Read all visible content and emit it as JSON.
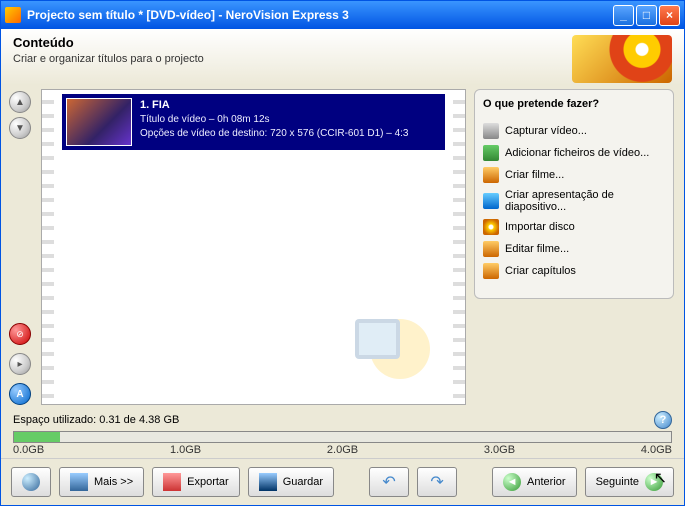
{
  "titlebar": {
    "title": "Projecto sem título * [DVD-vídeo] - NeroVision Express 3"
  },
  "header": {
    "title": "Conteúdo",
    "subtitle": "Criar e organizar títulos para o projecto"
  },
  "item": {
    "index": "1.",
    "name": "FIA",
    "line2": "Título de vídeo – 0h 08m 12s",
    "line3": "Opções de vídeo de destino: 720 x 576 (CCIR-601 D1) – 4:3"
  },
  "sidebar": {
    "heading": "O que pretende fazer?",
    "actions": {
      "capture": "Capturar vídeo...",
      "addfiles": "Adicionar ficheiros de vídeo...",
      "makemovie": "Criar filme...",
      "slideshow": "Criar apresentação de diapositivo...",
      "importdisc": "Importar disco",
      "editmovie": "Editar filme...",
      "chapters": "Criar capítulos"
    }
  },
  "space": {
    "label": "Espaço utilizado: 0.31 de 4.38 GB",
    "ticks": {
      "t0": "0.0GB",
      "t1": "1.0GB",
      "t2": "2.0GB",
      "t3": "3.0GB",
      "t4": "4.0GB"
    }
  },
  "footer": {
    "more": "Mais >>",
    "export": "Exportar",
    "save": "Guardar",
    "back": "Anterior",
    "next": "Seguinte"
  }
}
